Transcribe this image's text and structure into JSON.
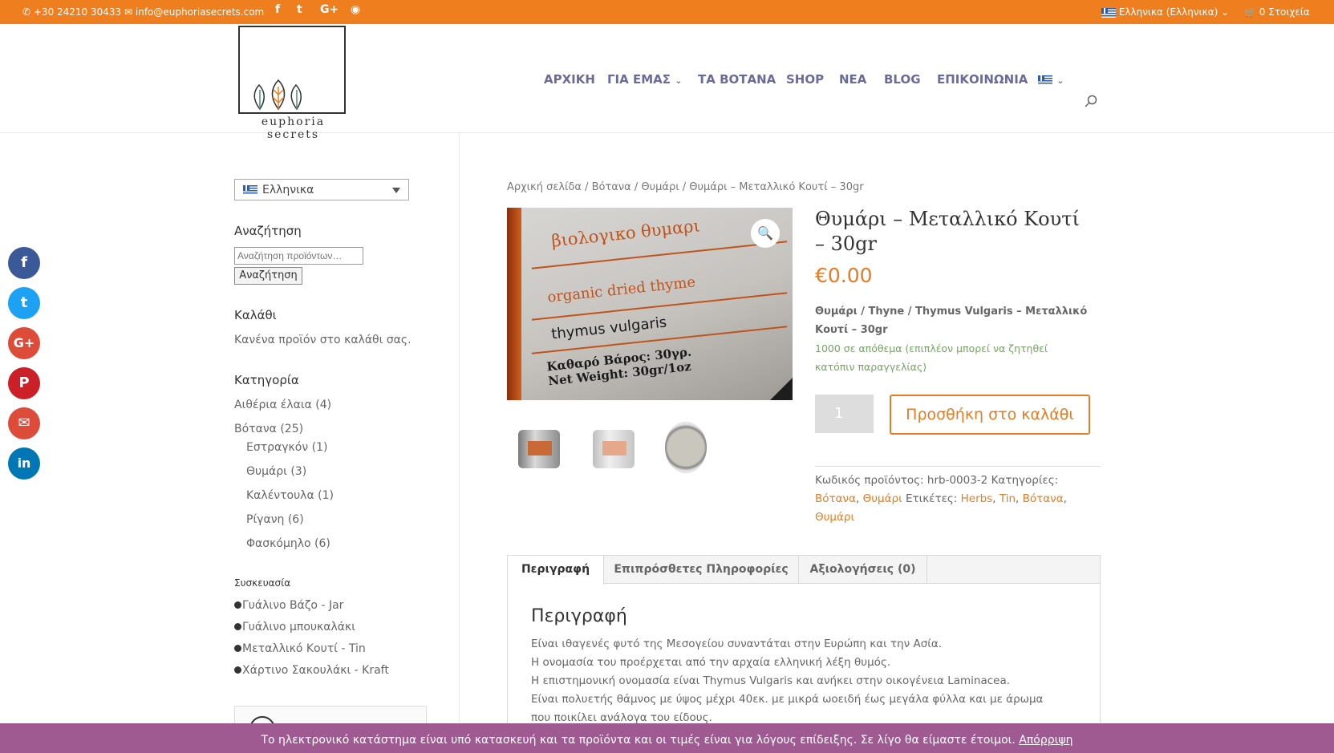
{
  "topbar": {
    "phone": "+30 24210 30433",
    "email": "info@euphoriasecrets.com",
    "language": "Ελληνικα (Ελληνικα)",
    "cart": "0 Στοιχεία",
    "social": [
      "facebook-icon",
      "twitter-icon",
      "google-plus-icon",
      "rss-icon"
    ]
  },
  "logo": {
    "text": "euphoria secrets"
  },
  "nav": {
    "items": [
      "ΑΡΧΙΚΗ",
      "ΓΙΑ ΕΜΑΣ",
      "ΤΑ ΒΟΤΑΝΑ",
      "SHOP",
      "ΝΕΑ",
      "BLOG",
      "ΕΠΙΚΟΙΝΩΝΙΑ"
    ]
  },
  "sidebar": {
    "language_select": "Ελληνικα",
    "search_title": "Αναζήτηση",
    "search_placeholder": "Αναζήτηση προϊόντων…",
    "search_button": "Αναζήτηση",
    "cart_title": "Καλάθι",
    "cart_empty": "Κανένα προϊόν στο καλάθι σας.",
    "category_title": "Κατηγορία",
    "categories": [
      {
        "label": "Αιθέρια έλαια",
        "count": "(4)"
      },
      {
        "label": "Βότανα",
        "count": "(25)"
      }
    ],
    "subcategories": [
      {
        "label": "Εστραγκόν",
        "count": "(1)"
      },
      {
        "label": "Θυμάρι",
        "count": "(3)"
      },
      {
        "label": "Καλέντουλα",
        "count": "(1)"
      },
      {
        "label": "Ρίγανη",
        "count": "(6)"
      },
      {
        "label": "Φασκόμηλο",
        "count": "(6)"
      }
    ],
    "packaging_title": "Συσκευασία",
    "packaging": [
      "Γυάλινο Βάζο - Jar",
      "Γυάλινο μπουκαλάκι",
      "Μεταλλικό Κουτί - Tin",
      "Χάρτινο Σακουλάκι - Kraft"
    ]
  },
  "share": [
    {
      "icon": "facebook-icon",
      "glyph": "f",
      "color": "#3b5998"
    },
    {
      "icon": "twitter-icon",
      "glyph": "t",
      "color": "#1da1f2"
    },
    {
      "icon": "google-plus-icon",
      "glyph": "G+",
      "color": "#dd4b39"
    },
    {
      "icon": "pinterest-icon",
      "glyph": "P",
      "color": "#cb2027"
    },
    {
      "icon": "email-icon",
      "glyph": "✉",
      "color": "#dd4b39"
    },
    {
      "icon": "linkedin-icon",
      "glyph": "in",
      "color": "#0077b5"
    }
  ],
  "breadcrumb": "Αρχική σελίδα / Βότανα / Θυμάρι / Θυμάρι – Μεταλλικό Κουτί – 30gr",
  "product": {
    "title": "Θυμάρι – Μεταλλικό Κουτί – 30gr",
    "price": "€0.00",
    "short_description": "Θυμάρι / Thyne / Thymus Vulgaris – Μεταλλικό Κουτί – 30gr",
    "stock": "1000 σε απόθεμα (επιπλέον μπορεί να ζητηθεί κατόπιν παραγγελίας)",
    "quantity": "1",
    "add_to_cart": "Προσθήκη στο καλάθι",
    "image_label": {
      "line1": "βιολογικο θυμαρι",
      "line2": "organic dried thyme",
      "line3": "thymus vulgaris",
      "line4": "Καθαρό Βάρος: 30γρ.",
      "line5": "Net Weight: 30gr/1oz"
    },
    "meta": {
      "sku_label": "Κωδικός προϊόντος:",
      "sku": "hrb-0003-2",
      "categories_label": "Κατηγορίες:",
      "categories": [
        "Βότανα",
        "Θυμάρι"
      ],
      "tags_label": "Ετικέτες:",
      "tags": [
        "Herbs",
        "Tin",
        "Βότανα",
        "Θυμάρι"
      ]
    }
  },
  "tabs": [
    "Περιγραφή",
    "Επιπρόσθετες Πληροφορίες",
    "Αξιολογήσεις (0)"
  ],
  "description": {
    "title": "Περιγραφή",
    "lines": [
      "Είναι ιθαγενές φυτό της Μεσογείου συναντάται στην Ευρώπη και την Ασία.",
      "Η ονομασία του προέρχεται από την αρχαία ελληνική λέξη θυμός.",
      "Η επιστημονική ονομασία είναι Thymus Vulgaris και ανήκει στην οικογένεια Laminacea.",
      "Είναι πολυετής θάμνος με ύψος μέχρι 40εκ. με μικρά ωοειδή έως μεγάλα φύλλα και με άρωμα που ποικίλει ανάλογα του είδους."
    ]
  },
  "cookie": {
    "text": "Το ηλεκτρονικό κατάστημα είναι υπό κατασκευή και τα προϊόντα και οι τιμές είναι για λόγους επίδειξης. Σε λίγο θα είμαστε έτοιμοι.",
    "dismiss": "Απόρριψη"
  },
  "colors": {
    "accent": "#e67c23",
    "topbar": "#ef7e1f",
    "nav": "#6b6b9b",
    "cookie": "#a05a92",
    "stock": "#77a464"
  }
}
